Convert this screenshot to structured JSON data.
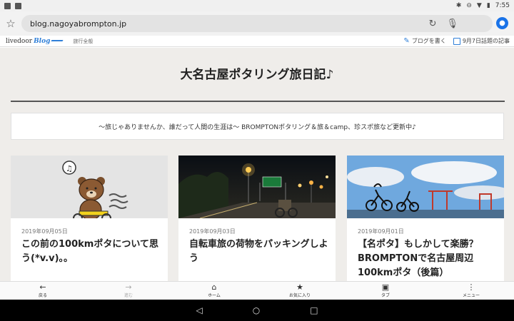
{
  "status": {
    "time": "7:55"
  },
  "browser": {
    "url": "blog.nagoyabrompton.jp"
  },
  "blog_header": {
    "logo_text": "livedoor",
    "logo_blog": "Blog",
    "category": "旅行全般",
    "write_blog": "ブログを書く",
    "topics": "9月7日話題の記事"
  },
  "blog": {
    "title": "大名古屋ポタリング旅日記♪",
    "description": "〜旅じゃありませんか、誰だって人間の生涯は〜 BROMPTONポタリング＆旅＆camp、珍スポ旅など更新中♪"
  },
  "posts": [
    {
      "date": "2019年09月05日",
      "title": "この前の100kmポタについて思う(*v.v)。。"
    },
    {
      "date": "2019年09月03日",
      "title": "自転車旅の荷物をパッキングしよう"
    },
    {
      "date": "2019年09月01日",
      "title": "【名ポタ】もしかして楽勝？BROMPTONで名古屋周辺100kmポタ（後篇）"
    }
  ],
  "bottom_nav": [
    {
      "label": "戻る",
      "icon": "back-arrow-icon"
    },
    {
      "label": "進む",
      "icon": "forward-arrow-icon"
    },
    {
      "label": "ホーム",
      "icon": "home-icon"
    },
    {
      "label": "お気に入り",
      "icon": "bookmark-icon"
    },
    {
      "label": "タブ",
      "icon": "tabs-icon"
    },
    {
      "label": "メニュー",
      "icon": "menu-icon"
    }
  ],
  "colors": {
    "accent": "#2f7fd8",
    "page_bg": "#efedea",
    "account": "#1a73e8"
  }
}
